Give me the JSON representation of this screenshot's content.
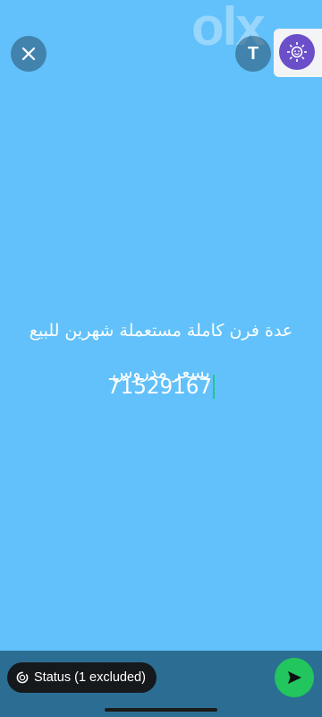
{
  "watermark": {
    "text": "olx"
  },
  "toolbar": {
    "close_icon": "close-icon",
    "text_tool_label": "T",
    "sticker_icon": "emoji-sticker-icon"
  },
  "message": {
    "line1": "عدة فرن كاملة مستعملة شهرين  للبيع",
    "line2": "بسعر مدروس",
    "line3": "71529167"
  },
  "bottom": {
    "status_label": "Status (1 excluded)",
    "status_icon": "status-ring-icon",
    "send_icon": "send-arrow-icon"
  },
  "colors": {
    "background": "#62c1fa",
    "accent": "#22c55e",
    "cursor": "#1ec88b",
    "bar": "#2c6e93"
  }
}
